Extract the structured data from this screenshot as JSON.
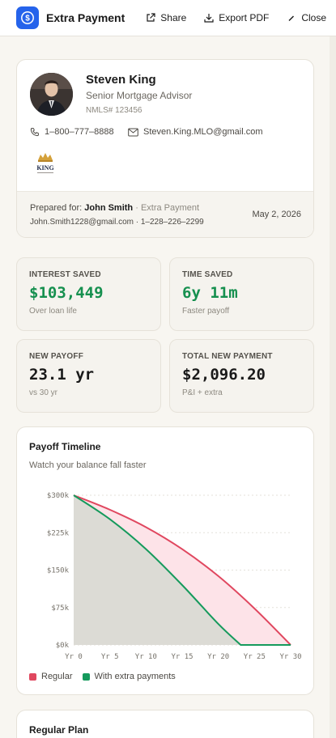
{
  "header": {
    "title": "Extra Payment",
    "actions": [
      {
        "label": "Share",
        "icon": "share-icon"
      },
      {
        "label": "Export PDF",
        "icon": "download-icon"
      },
      {
        "label": "Close",
        "icon": "close-icon"
      }
    ]
  },
  "profile": {
    "name": "Steven King",
    "role": "Senior Mortgage Advisor",
    "nmls": "NMLS# 123456",
    "phone": "1–800–777–8888",
    "email": "Steven.King.MLO@gmail.com",
    "logo_text": "KING"
  },
  "prepared": {
    "label": "Prepared for:",
    "client": "John Smith",
    "context": "· Extra Payment",
    "contact": "John.Smith1228@gmail.com · 1–228–226–2299",
    "date": "May 2, 2026"
  },
  "stats": [
    {
      "label": "INTEREST SAVED",
      "value": "$103,449",
      "sub": "Over loan life",
      "highlight": true
    },
    {
      "label": "TIME SAVED",
      "value": "6y 11m",
      "sub": "Faster payoff",
      "highlight": true
    },
    {
      "label": "NEW PAYOFF",
      "value": "23.1 yr",
      "sub": "vs 30 yr",
      "highlight": false
    },
    {
      "label": "TOTAL NEW PAYMENT",
      "value": "$2,096.20",
      "sub": "P&I + extra",
      "highlight": false
    }
  ],
  "chart": {
    "title": "Payoff Timeline",
    "subtitle": "Watch your balance fall faster"
  },
  "chart_data": {
    "type": "area",
    "xlabel": "",
    "ylabel": "",
    "x_ticks": [
      "Yr 0",
      "Yr 5",
      "Yr 10",
      "Yr 15",
      "Yr 20",
      "Yr 25",
      "Yr 30"
    ],
    "y_ticks": [
      "$300k",
      "$225k",
      "$150k",
      "$75k",
      "$0k"
    ],
    "xlim": [
      0,
      30
    ],
    "ylim": [
      0,
      300000
    ],
    "grid": true,
    "legend_position": "bottom-left",
    "series": [
      {
        "name": "Regular",
        "color": "#e0475f",
        "x": [
          0,
          5,
          10,
          15,
          20,
          25,
          30
        ],
        "y": [
          300000,
          271000,
          236000,
          192000,
          138000,
          73000,
          0
        ]
      },
      {
        "name": "With extra payments",
        "color": "#159a5c",
        "x": [
          0,
          5,
          10,
          15,
          20,
          23.1,
          30
        ],
        "y": [
          300000,
          252000,
          192000,
          120000,
          42000,
          0,
          0
        ]
      }
    ]
  },
  "plan": {
    "title": "Regular Plan"
  },
  "colors": {
    "accent": "#2563eb",
    "positive": "#16904f",
    "regular_series": "#e0475f",
    "extra_series": "#159a5c"
  }
}
